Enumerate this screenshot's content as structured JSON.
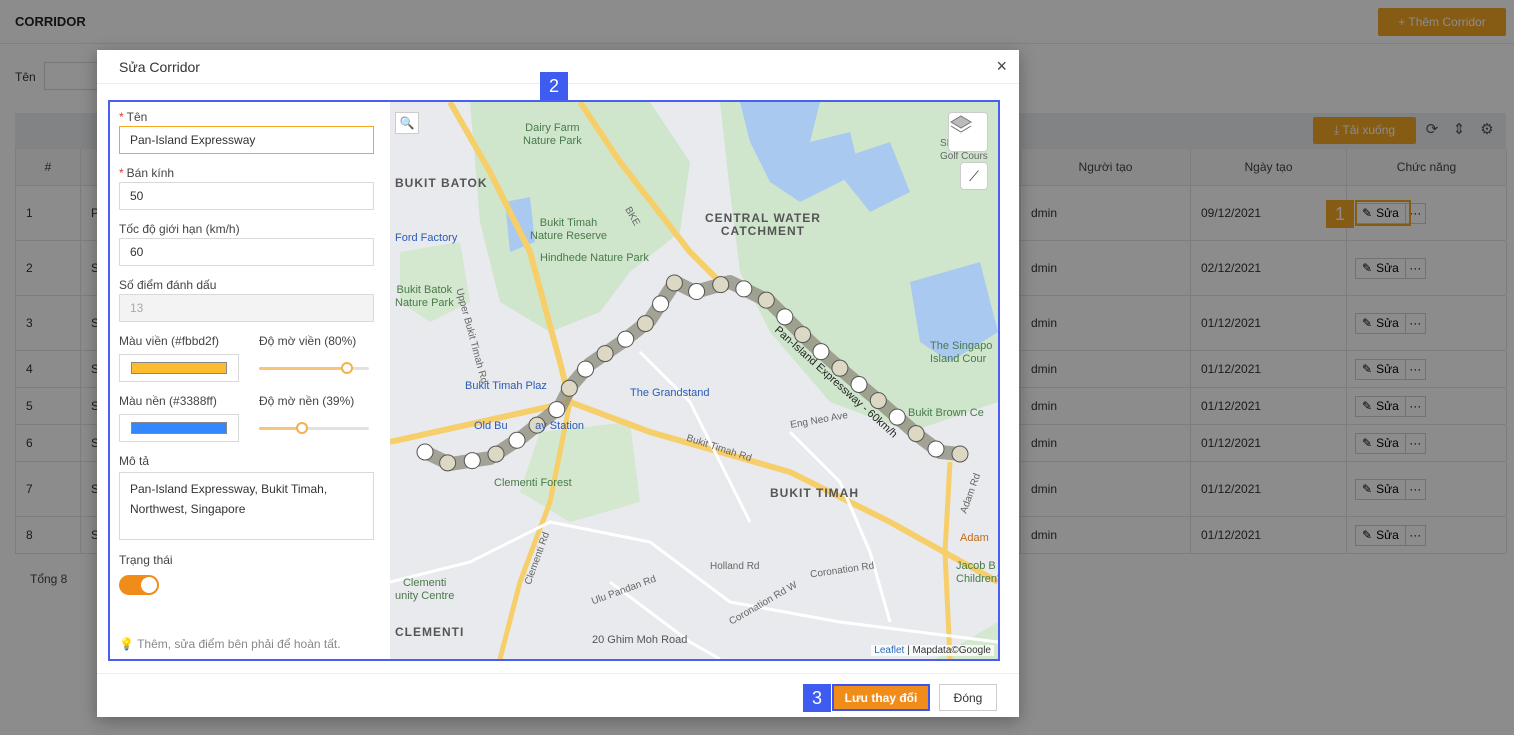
{
  "app": {
    "title": "CORRIDOR",
    "add_button": "+ Thêm Corridor",
    "filter_label": "Tên",
    "download_button": "⤓ Tải xuống",
    "total": "Tổng 8"
  },
  "table": {
    "headers": {
      "index": "#",
      "creator": "Người tạo",
      "date": "Ngày tạo",
      "actions": "Chức năng"
    },
    "edit_label": "Sửa",
    "more_label": "···",
    "rows": [
      {
        "index": "1",
        "name": "P",
        "creator": "dmin",
        "date": "09/12/2021"
      },
      {
        "index": "2",
        "name": "S",
        "creator": "dmin",
        "date": "02/12/2021"
      },
      {
        "index": "3",
        "name": "S",
        "creator": "dmin",
        "date": "01/12/2021"
      },
      {
        "index": "4",
        "name": "S",
        "creator": "dmin",
        "date": "01/12/2021"
      },
      {
        "index": "5",
        "name": "S",
        "creator": "dmin",
        "date": "01/12/2021"
      },
      {
        "index": "6",
        "name": "S",
        "creator": "dmin",
        "date": "01/12/2021"
      },
      {
        "index": "7",
        "name": "S H",
        "creator": "dmin",
        "date": "01/12/2021"
      },
      {
        "index": "8",
        "name": "S",
        "creator": "dmin",
        "date": "01/12/2021"
      }
    ]
  },
  "modal": {
    "title": "Sửa Corridor",
    "close_icon": "×",
    "fields": {
      "name_label": "Tên",
      "name_value": "Pan-Island Expressway",
      "radius_label": "Bán kính",
      "radius_value": "50",
      "speed_label": "Tốc độ giới hạn (km/h)",
      "speed_value": "60",
      "points_label": "Số điểm đánh dấu",
      "points_value": "13",
      "border_color_label": "Màu viền (#fbbd2f)",
      "border_color": "#fbbd2f",
      "border_opacity_label": "Độ mờ viền (80%)",
      "border_opacity": 0.8,
      "fill_color_label": "Màu nền (#3388ff)",
      "fill_color": "#3388ff",
      "fill_opacity_label": "Độ mờ nền (39%)",
      "fill_opacity": 0.39,
      "desc_label": "Mô tả",
      "desc_value": "Pan-Island Expressway, Bukit Timah, Northwest, Singapore",
      "status_label": "Trạng thái",
      "status_on": true,
      "hint": "Thêm, sửa điểm bên phải để hoàn tất."
    },
    "save_button": "Lưu thay đổi",
    "close_button": "Đóng"
  },
  "map": {
    "labels": {
      "dairy_farm": "Dairy Farm\nNature Park",
      "sicc": "SICC H\nGolf Cours",
      "bukit_batok": "BUKIT BATOK",
      "central_water": "CENTRAL WATER\nCATCHMENT",
      "ford_factory": "Ford Factory",
      "bukit_timah_reserve": "Bukit Timah\nNature Reserve",
      "hindhede": "Hindhede Nature Park",
      "bukit_batok_park": "Bukit Batok\nNature Park",
      "singapore_island": "The Singapo\nIsland Cour",
      "bukit_timah_plaza": "Bukit Timah Plaz",
      "grandstand": "The Grandstand",
      "bukit_brown": "Bukit Brown Ce",
      "old_bukit": "Old Bu         ay Station",
      "clementi_forest": "Clementi Forest",
      "bukit_timah_area": "BUKIT TIMAH",
      "adam": "Adam",
      "jacob": "Jacob B\nChildren's",
      "clementi_centre": "Clementi\nunity Centre",
      "clementi_area": "CLEMENTI",
      "ghim_moh": "20 Ghim Moh Road",
      "upper_bukit_timah": "Upper Bukit Timah Rd",
      "bukit_timah_rd": "Bukit Timah Rd",
      "clementi_rd": "Clementi Rd",
      "eng_neo": "Eng Neo Ave",
      "adam_rd": "Adam Rd",
      "pie_label": "Pan-Island Expressway - 60km/h",
      "bke": "BKE",
      "ulu_pandan": "Ulu Pandan Rd",
      "coronation": "Coronation Rd",
      "coronation_w": "Coronation Rd W",
      "holland": "Holland Rd"
    },
    "attribution_leaflet": "Leaflet",
    "attribution_rest": " | Mapdata©Google"
  },
  "annotations": {
    "step1": "1",
    "step2": "2",
    "step3": "3"
  }
}
